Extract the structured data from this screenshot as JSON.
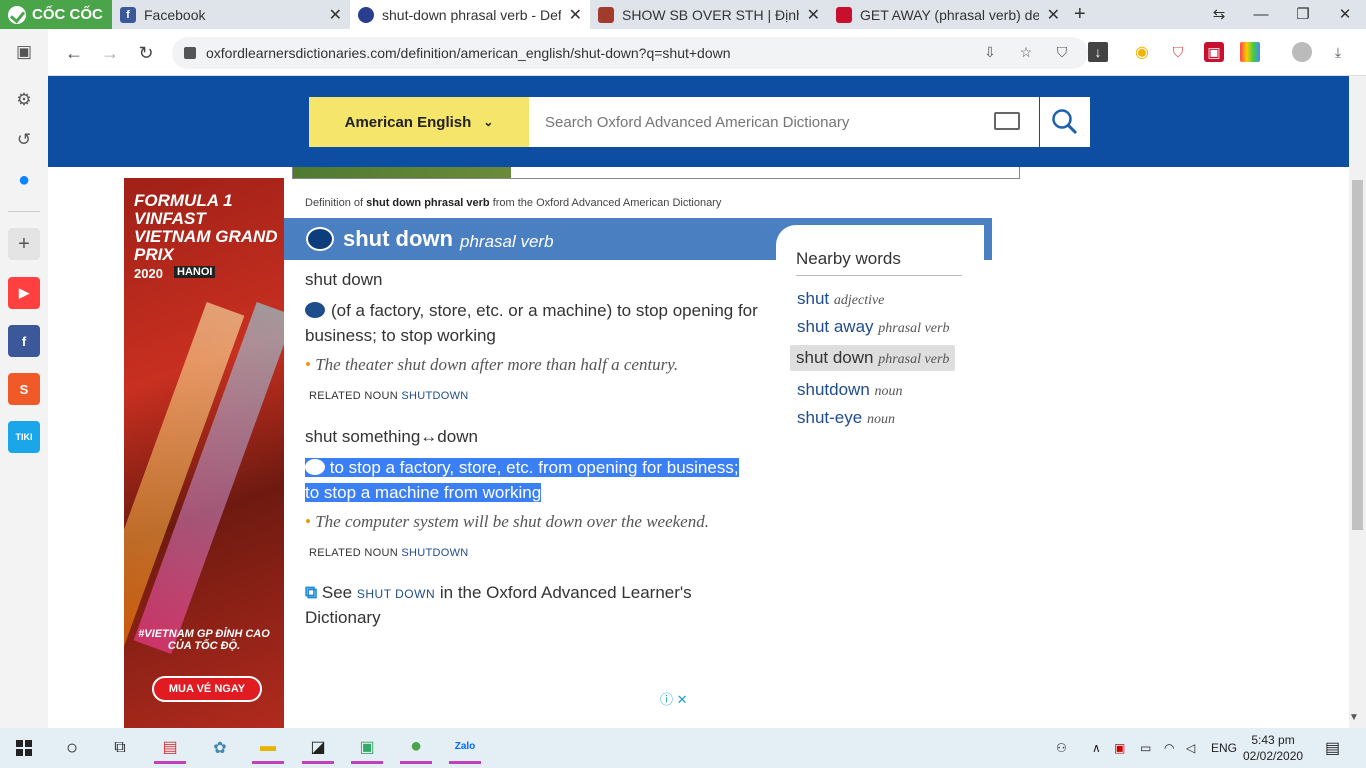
{
  "browser": {
    "brand_label": "CỐC CỐC",
    "tabs": [
      {
        "title": "Facebook",
        "color": "#3b5998",
        "glyph": "f"
      },
      {
        "title": "shut-down phrasal verb - Def",
        "color": "#2a3d8f",
        "glyph": ""
      },
      {
        "title": "SHOW SB OVER STH | Định ng",
        "color": "#a13b2c",
        "glyph": ""
      },
      {
        "title": "GET AWAY (phrasal verb) defi",
        "color": "#c8102e",
        "glyph": ""
      }
    ],
    "url": "oxfordlearnersdictionaries.com/definition/american_english/shut-down?q=shut+down"
  },
  "sidebar_apps": [
    {
      "name": "youtube",
      "color": "#ff4040",
      "glyph": "▶"
    },
    {
      "name": "facebook",
      "color": "#3b5998",
      "glyph": "f"
    },
    {
      "name": "shopee",
      "color": "#f05a28",
      "glyph": "S"
    },
    {
      "name": "tiki",
      "color": "#1aa6e8",
      "glyph": "TIKI"
    }
  ],
  "header": {
    "language": "American English",
    "search_placeholder": "Search Oxford Advanced American Dictionary"
  },
  "ad": {
    "title": "FORMULA 1 VINFAST VIETNAM GRAND PRIX",
    "year": "2020",
    "city": "HANOI",
    "tagline": "#VIETNAM GP ĐỈNH CAO CỦA TỐC ĐỘ.",
    "cta": "MUA VÉ NGAY"
  },
  "entry": {
    "definition_of_prefix": "Definition of",
    "definition_of_term": "shut down phrasal verb",
    "definition_of_suffix": "from the Oxford Advanced American Dictionary",
    "headword": "shut down",
    "pos": "phrasal verb",
    "senses": [
      {
        "phrase": "shut down",
        "definition": "(of a factory, store, etc. or a machine) to stop opening for business; to stop working",
        "example": "The theater shut down after more than half a century.",
        "related_label": "RELATED NOUN",
        "related_word": "SHUTDOWN"
      },
      {
        "phrase": "shut something↔down",
        "definition_line1": "to stop a factory, store, etc. from opening for business;",
        "definition_line2": "to stop a machine from working",
        "example": "The computer system will be shut down over the weekend.",
        "related_label": "RELATED NOUN",
        "related_word": "SHUTDOWN"
      }
    ],
    "see_prefix": "See",
    "see_link": "SHUT DOWN",
    "see_suffix": "in the Oxford Advanced Learner's Dictionary"
  },
  "nearby": {
    "heading": "Nearby words",
    "items": [
      {
        "word": "shut",
        "pos": "adjective"
      },
      {
        "word": "shut away",
        "pos": "phrasal verb"
      },
      {
        "word": "shut down",
        "pos": "phrasal verb",
        "selected": true
      },
      {
        "word": "shutdown",
        "pos": "noun"
      },
      {
        "word": "shut-eye",
        "pos": "noun"
      }
    ]
  },
  "taskbar": {
    "language": "ENG",
    "time": "5:43 pm",
    "date": "02/02/2020"
  }
}
